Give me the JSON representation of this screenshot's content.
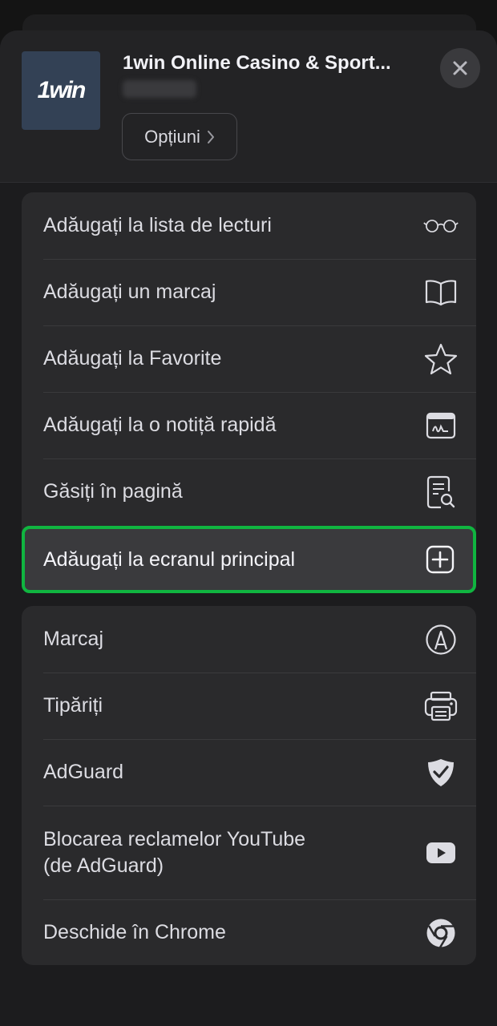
{
  "header": {
    "app_icon_text": "1win",
    "title": "1win Online Casino & Sport...",
    "options_label": "Opțiuni",
    "options_chevron": "chevron-right-icon",
    "close_icon": "close-icon"
  },
  "menu_group_1": [
    {
      "label": "Adăugați la lista de lecturi",
      "icon": "glasses-icon"
    },
    {
      "label": "Adăugați un marcaj",
      "icon": "book-icon"
    },
    {
      "label": "Adăugați la Favorite",
      "icon": "star-icon"
    },
    {
      "label": "Adăugați la o notiță rapidă",
      "icon": "quick-note-icon"
    },
    {
      "label": "Găsiți în pagină",
      "icon": "find-in-page-icon"
    }
  ],
  "highlighted_item": {
    "label": "Adăugați la ecranul principal",
    "icon": "add-square-icon"
  },
  "menu_group_2": [
    {
      "label": "Marcaj",
      "icon": "markup-pen-icon"
    },
    {
      "label": "Tipăriți",
      "icon": "printer-icon"
    },
    {
      "label": "AdGuard",
      "icon": "shield-check-icon"
    },
    {
      "label_line1": "Blocarea reclamelor YouTube",
      "label_line2": "(de AdGuard)",
      "icon": "youtube-play-icon"
    },
    {
      "label": "Deschide în Chrome",
      "icon": "chrome-icon"
    }
  ],
  "colors": {
    "highlight_border": "#10b540",
    "sheet_bg": "#1c1c1e",
    "row_bg": "#2a2a2c"
  }
}
